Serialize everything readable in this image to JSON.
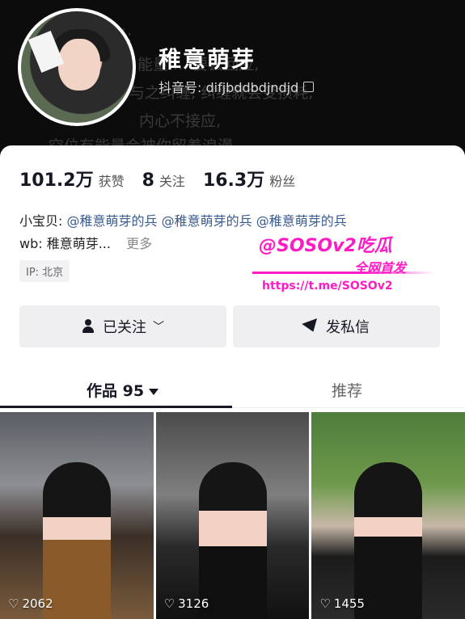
{
  "header": {
    "nickname": "稚意萌芽",
    "douyin_id": "抖音号: difjbddbdjndjd",
    "bg_lines": [
      "说:",
      "能量 ... 要去回应,",
      "与之纠缠, 纠缠就会变损耗,",
      "内心不接应,",
      "空位有能量会被你留着浪漫"
    ]
  },
  "stats": {
    "likes_value": "101.2万",
    "likes_label": "获赞",
    "following_value": "8",
    "following_label": "关注",
    "followers_value": "16.3万",
    "followers_label": "粉丝"
  },
  "bio": {
    "line1_prefix": "小宝贝:",
    "mentions": [
      "@稚意萌芽的兵",
      "@稚意萌芽的兵",
      "@稚意萌芽的兵"
    ],
    "line2": "wb: 稚意萌芽...",
    "more": "更多",
    "ip": "IP: 北京"
  },
  "watermark": {
    "line1": "@SOSOv2吃瓜",
    "line2": "全网首发",
    "line3": "https://t.me/SOSOv2",
    "color": "#ff1cc4"
  },
  "actions": {
    "follow_label": "已关注",
    "message_label": "发私信"
  },
  "tabs": {
    "works_label": "作品 95",
    "recommend_label": "推荐"
  },
  "videos": [
    {
      "likes": "2062"
    },
    {
      "likes": "3126"
    },
    {
      "likes": "1455"
    }
  ],
  "icons": [
    "copy-icon",
    "person-check-icon",
    "chevron-down-icon",
    "send-icon",
    "heart-icon"
  ]
}
